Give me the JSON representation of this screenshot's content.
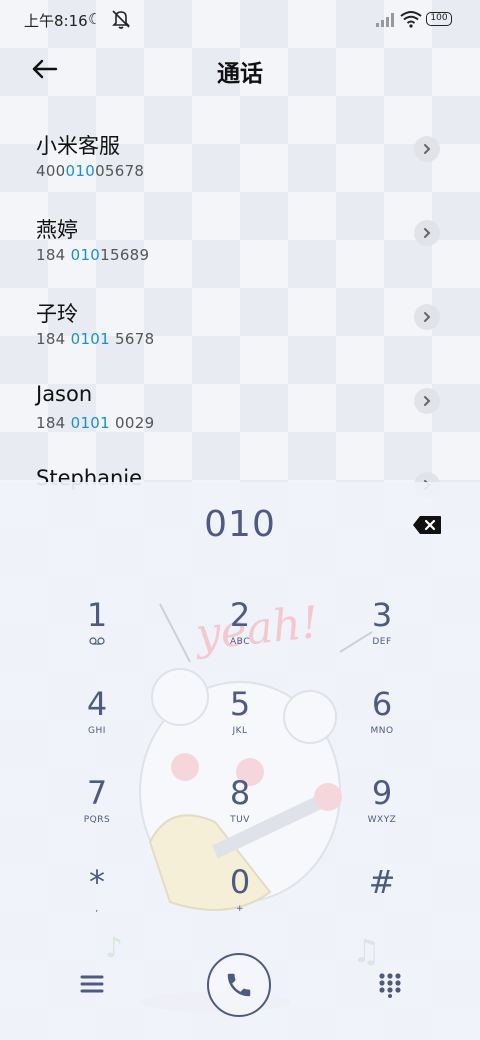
{
  "status_bar": {
    "time": "上午8:16",
    "battery": "100"
  },
  "header": {
    "title": "通话"
  },
  "contacts": [
    {
      "name": "小米客服",
      "number_pre": "400",
      "number_hl": "010",
      "number_post": "05678"
    },
    {
      "name": "燕婷",
      "number_pre": "184 ",
      "number_hl": "010",
      "number_post": "15689"
    },
    {
      "name": "子玲",
      "number_pre": "184 ",
      "number_hl": "0101",
      "number_post": " 5678"
    },
    {
      "name": "Jason",
      "number_pre": "184 ",
      "number_hl": "0101",
      "number_post": " 0029"
    },
    {
      "name": "Stephanie",
      "number_pre": "",
      "number_hl": "",
      "number_post": ""
    }
  ],
  "dialer": {
    "display": "010",
    "keys": [
      {
        "digit": "1",
        "sub": "voicemail-icon"
      },
      {
        "digit": "2",
        "sub": "ABC"
      },
      {
        "digit": "3",
        "sub": "DEF"
      },
      {
        "digit": "4",
        "sub": "GHI"
      },
      {
        "digit": "5",
        "sub": "JKL"
      },
      {
        "digit": "6",
        "sub": "MNO"
      },
      {
        "digit": "7",
        "sub": "PQRS"
      },
      {
        "digit": "8",
        "sub": "TUV"
      },
      {
        "digit": "9",
        "sub": "WXYZ"
      },
      {
        "digit": "*",
        "sub": ","
      },
      {
        "digit": "0",
        "sub": "+"
      },
      {
        "digit": "#",
        "sub": ""
      }
    ],
    "doodle_text": "yeah!"
  },
  "colors": {
    "accent": "#1a8fd1",
    "dialer_ink": "#4e5b80"
  }
}
